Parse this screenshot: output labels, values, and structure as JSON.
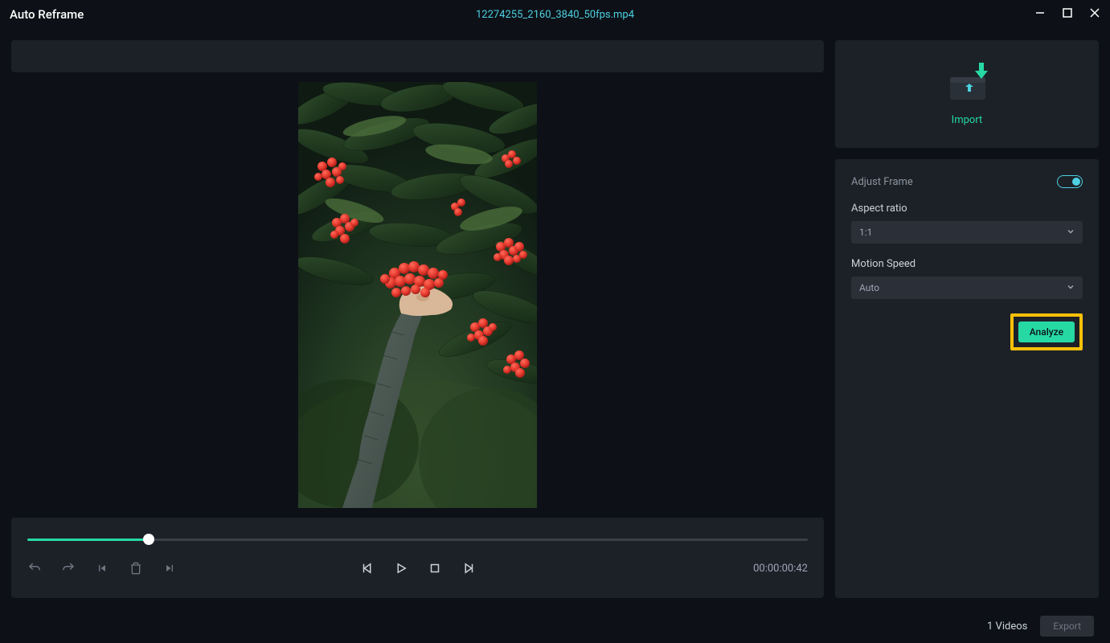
{
  "titlebar": {
    "title": "Auto Reframe",
    "filename": "12274255_2160_3840_50fps.mp4"
  },
  "import": {
    "label": "Import"
  },
  "settings": {
    "adjust_frame_label": "Adjust Frame",
    "aspect_ratio_label": "Aspect ratio",
    "aspect_ratio_value": "1:1",
    "motion_speed_label": "Motion Speed",
    "motion_speed_value": "Auto",
    "analyze_label": "Analyze"
  },
  "playback": {
    "timestamp": "00:00:00:42"
  },
  "footer": {
    "video_count": "1 Videos",
    "export_label": "Export"
  }
}
